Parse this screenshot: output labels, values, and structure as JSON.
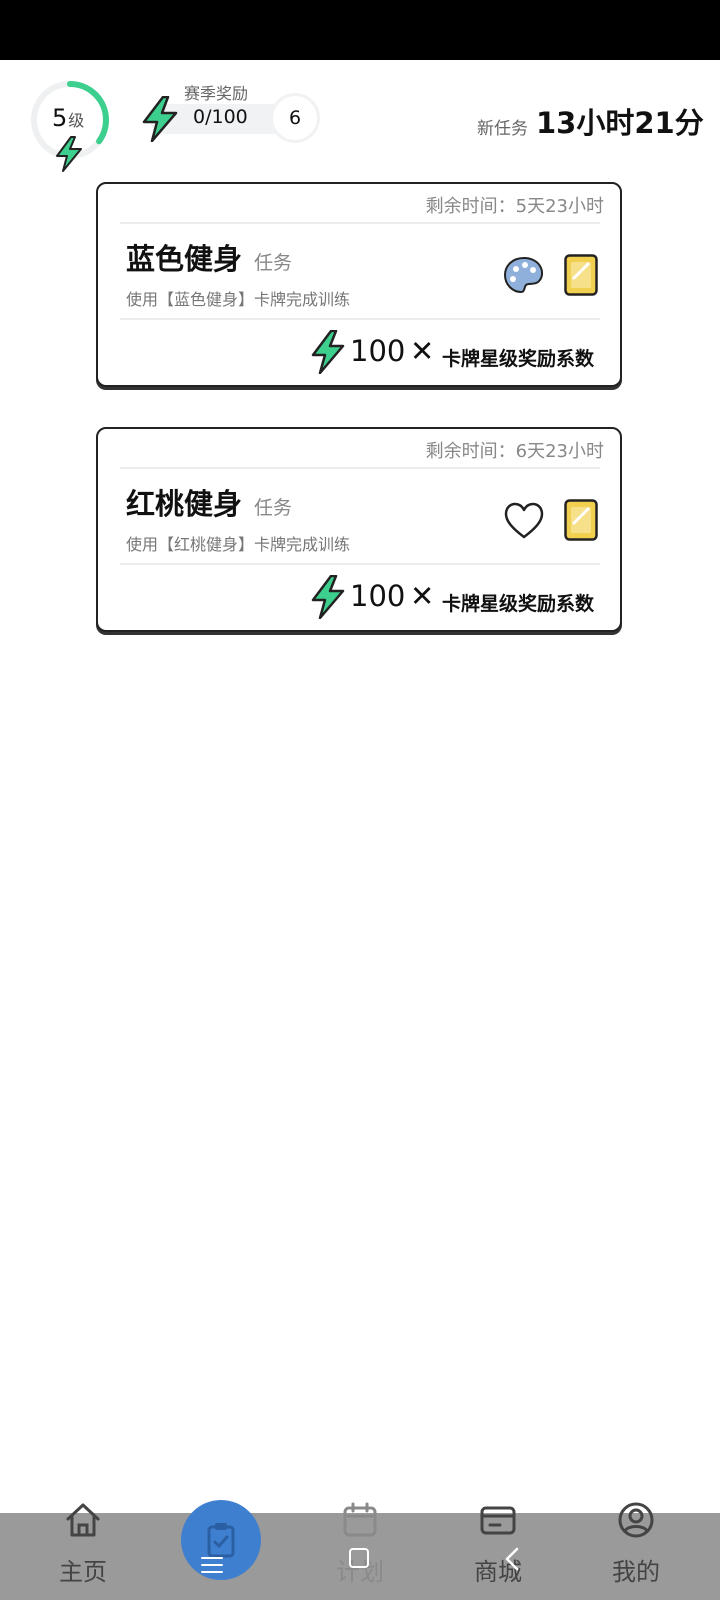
{
  "header": {
    "level_number": "5",
    "level_unit": "级",
    "level_progress": 0.35,
    "season_title": "赛季奖励",
    "season_progress": "0/100",
    "season_count": "6",
    "new_task_label": "新任务",
    "new_task_time": "13小时21分"
  },
  "tasks": [
    {
      "remaining": "剩余时间：5天23小时",
      "title": "蓝色健身",
      "tag": "任务",
      "desc": "使用【蓝色健身】卡牌完成训练",
      "icon": "palette-icon",
      "reward_amount": "100",
      "reward_times": "✕",
      "reward_desc": "卡牌星级奖励系数"
    },
    {
      "remaining": "剩余时间：6天23小时",
      "title": "红桃健身",
      "tag": "任务",
      "desc": "使用【红桃健身】卡牌完成训练",
      "icon": "heart-icon",
      "reward_amount": "100",
      "reward_times": "✕",
      "reward_desc": "卡牌星级奖励系数"
    }
  ],
  "nav": {
    "home": "主页",
    "plan": "计划",
    "shop": "商城",
    "me": "我的"
  },
  "colors": {
    "accent_green": "#3ccf8e",
    "nav_active_blue": "#3f7fd0",
    "card_yellow": "#f2d04f",
    "bottom_nav_bg": "#9a9a9a"
  }
}
